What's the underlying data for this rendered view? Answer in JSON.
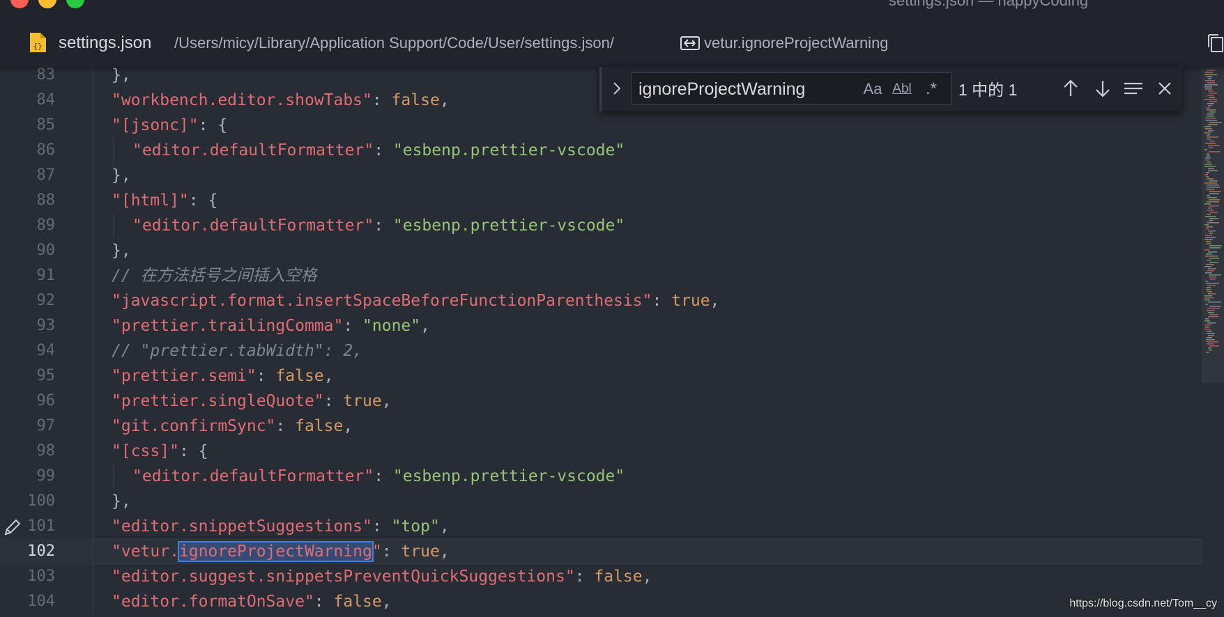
{
  "window": {
    "title": "settings.json — happyCoding"
  },
  "breadcrumb": {
    "file_icon": "json-file-icon",
    "filename": "settings.json",
    "path": "/Users/micy/Library/Application Support/Code/User/settings.json/",
    "symbol_icon": "string-symbol-icon",
    "symbol": "vetur.ignoreProjectWarning",
    "split_icon": "split-editor-icon"
  },
  "find": {
    "toggle_icon": "chevron-right-icon",
    "query": "ignoreProjectWarning",
    "match_case_label": "Aa",
    "whole_word_label": "Abl",
    "regex_label": ".*",
    "count": "1 中的 1",
    "prev_icon": "arrow-up-icon",
    "next_icon": "arrow-down-icon",
    "selection_icon": "find-in-selection-icon",
    "close_icon": "close-icon"
  },
  "editor": {
    "current_line": 102,
    "colors": {
      "key": "#e06c75",
      "string": "#98c379",
      "boolean": "#d19a66",
      "comment": "#7f848e",
      "punctuation": "#abb2bf",
      "match_outline": "#3f7fe0"
    },
    "lines": [
      {
        "n": "83",
        "tokens": [
          {
            "t": "p",
            "v": "},"
          }
        ]
      },
      {
        "n": "84",
        "tokens": [
          {
            "t": "k",
            "v": "\"workbench.editor.showTabs\""
          },
          {
            "t": "p",
            "v": ": "
          },
          {
            "t": "b",
            "v": "false"
          },
          {
            "t": "p",
            "v": ","
          }
        ]
      },
      {
        "n": "85",
        "tokens": [
          {
            "t": "k",
            "v": "\"[jsonc]\""
          },
          {
            "t": "p",
            "v": ": {"
          }
        ]
      },
      {
        "n": "86",
        "indent": 2,
        "tokens": [
          {
            "t": "k",
            "v": "\"editor.defaultFormatter\""
          },
          {
            "t": "p",
            "v": ": "
          },
          {
            "t": "s",
            "v": "\"esbenp.prettier-vscode\""
          }
        ]
      },
      {
        "n": "87",
        "tokens": [
          {
            "t": "p",
            "v": "},"
          }
        ]
      },
      {
        "n": "88",
        "tokens": [
          {
            "t": "k",
            "v": "\"[html]\""
          },
          {
            "t": "p",
            "v": ": {"
          }
        ]
      },
      {
        "n": "89",
        "indent": 2,
        "tokens": [
          {
            "t": "k",
            "v": "\"editor.defaultFormatter\""
          },
          {
            "t": "p",
            "v": ": "
          },
          {
            "t": "s",
            "v": "\"esbenp.prettier-vscode\""
          }
        ]
      },
      {
        "n": "90",
        "tokens": [
          {
            "t": "p",
            "v": "},"
          }
        ]
      },
      {
        "n": "91",
        "tokens": [
          {
            "t": "c",
            "v": "// 在方法括号之间插入空格"
          }
        ]
      },
      {
        "n": "92",
        "tokens": [
          {
            "t": "k",
            "v": "\"javascript.format.insertSpaceBeforeFunctionParenthesis\""
          },
          {
            "t": "p",
            "v": ": "
          },
          {
            "t": "b",
            "v": "true"
          },
          {
            "t": "p",
            "v": ","
          }
        ]
      },
      {
        "n": "93",
        "tokens": [
          {
            "t": "k",
            "v": "\"prettier.trailingComma\""
          },
          {
            "t": "p",
            "v": ": "
          },
          {
            "t": "s",
            "v": "\"none\""
          },
          {
            "t": "p",
            "v": ","
          }
        ]
      },
      {
        "n": "94",
        "tokens": [
          {
            "t": "c",
            "v": "// \"prettier.tabWidth\": 2,"
          }
        ]
      },
      {
        "n": "95",
        "tokens": [
          {
            "t": "k",
            "v": "\"prettier.semi\""
          },
          {
            "t": "p",
            "v": ": "
          },
          {
            "t": "b",
            "v": "false"
          },
          {
            "t": "p",
            "v": ","
          }
        ]
      },
      {
        "n": "96",
        "tokens": [
          {
            "t": "k",
            "v": "\"prettier.singleQuote\""
          },
          {
            "t": "p",
            "v": ": "
          },
          {
            "t": "b",
            "v": "true"
          },
          {
            "t": "p",
            "v": ","
          }
        ]
      },
      {
        "n": "97",
        "tokens": [
          {
            "t": "k",
            "v": "\"git.confirmSync\""
          },
          {
            "t": "p",
            "v": ": "
          },
          {
            "t": "b",
            "v": "false"
          },
          {
            "t": "p",
            "v": ","
          }
        ]
      },
      {
        "n": "98",
        "tokens": [
          {
            "t": "k",
            "v": "\"[css]\""
          },
          {
            "t": "p",
            "v": ": {"
          }
        ]
      },
      {
        "n": "99",
        "indent": 2,
        "tokens": [
          {
            "t": "k",
            "v": "\"editor.defaultFormatter\""
          },
          {
            "t": "p",
            "v": ": "
          },
          {
            "t": "s",
            "v": "\"esbenp.prettier-vscode\""
          }
        ]
      },
      {
        "n": "100",
        "tokens": [
          {
            "t": "p",
            "v": "},"
          }
        ]
      },
      {
        "n": "101",
        "tokens": [
          {
            "t": "k",
            "v": "\"editor.snippetSuggestions\""
          },
          {
            "t": "p",
            "v": ": "
          },
          {
            "t": "s",
            "v": "\"top\""
          },
          {
            "t": "p",
            "v": ","
          }
        ]
      },
      {
        "n": "102",
        "tokens": [
          {
            "t": "k",
            "v": "\"vetur."
          },
          {
            "t": "m",
            "v": "ignoreProjectWarning"
          },
          {
            "t": "k",
            "v": "\""
          },
          {
            "t": "p",
            "v": ": "
          },
          {
            "t": "b",
            "v": "true"
          },
          {
            "t": "p",
            "v": ","
          }
        ]
      },
      {
        "n": "103",
        "tokens": [
          {
            "t": "k",
            "v": "\"editor.suggest.snippetsPreventQuickSuggestions\""
          },
          {
            "t": "p",
            "v": ": "
          },
          {
            "t": "b",
            "v": "false"
          },
          {
            "t": "p",
            "v": ","
          }
        ]
      },
      {
        "n": "104",
        "tokens": [
          {
            "t": "k",
            "v": "\"editor.formatOnSave\""
          },
          {
            "t": "p",
            "v": ": "
          },
          {
            "t": "b",
            "v": "false"
          },
          {
            "t": "p",
            "v": ","
          }
        ]
      }
    ],
    "gutter_icon": "edit-pencil-icon",
    "gutter_icon_line": 101
  },
  "watermark": "https://blog.csdn.net/Tom__cy"
}
